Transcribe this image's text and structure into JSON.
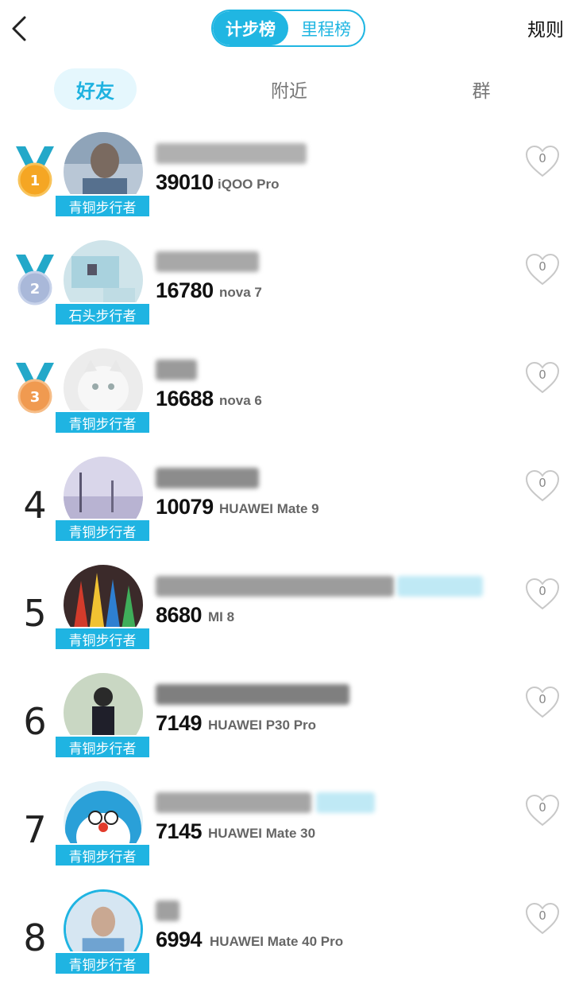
{
  "header": {
    "tabs": [
      {
        "label": "计步榜",
        "active": true
      },
      {
        "label": "里程榜",
        "active": false
      }
    ],
    "rules_label": "规则"
  },
  "subtabs": {
    "friends": "好友",
    "nearby": "附近",
    "group": "群"
  },
  "colors": {
    "accent": "#20b6e2",
    "badge": "#1fb4e2",
    "gold": "#f5a623",
    "silver": "#a9b8d9",
    "bronze": "#f09a50",
    "ribbon": "#23a8c9"
  },
  "rows": [
    {
      "rank": "1",
      "medal": "gold-medal",
      "title": "青铜步行者",
      "steps": "39010",
      "device": "iQOO Pro",
      "likes": "0"
    },
    {
      "rank": "2",
      "medal": "silver-medal",
      "title": "石头步行者",
      "steps": "16780",
      "device": "nova 7",
      "likes": "0"
    },
    {
      "rank": "3",
      "medal": "bronze-medal",
      "title": "青铜步行者",
      "steps": "16688",
      "device": "nova 6",
      "likes": "0"
    },
    {
      "rank": "4",
      "medal": "",
      "title": "青铜步行者",
      "steps": "10079",
      "device": "HUAWEI Mate 9",
      "likes": "0"
    },
    {
      "rank": "5",
      "medal": "",
      "title": "青铜步行者",
      "steps": "8680",
      "device": "MI 8",
      "likes": "0"
    },
    {
      "rank": "6",
      "medal": "",
      "title": "青铜步行者",
      "steps": "7149",
      "device": "HUAWEI P30 Pro",
      "likes": "0"
    },
    {
      "rank": "7",
      "medal": "",
      "title": "青铜步行者",
      "steps": "7145",
      "device": "HUAWEI Mate 30",
      "likes": "0"
    },
    {
      "rank": "8",
      "medal": "",
      "title": "青铜步行者",
      "steps": "6994",
      "device": "HUAWEI Mate 40 Pro",
      "likes": "0"
    }
  ]
}
